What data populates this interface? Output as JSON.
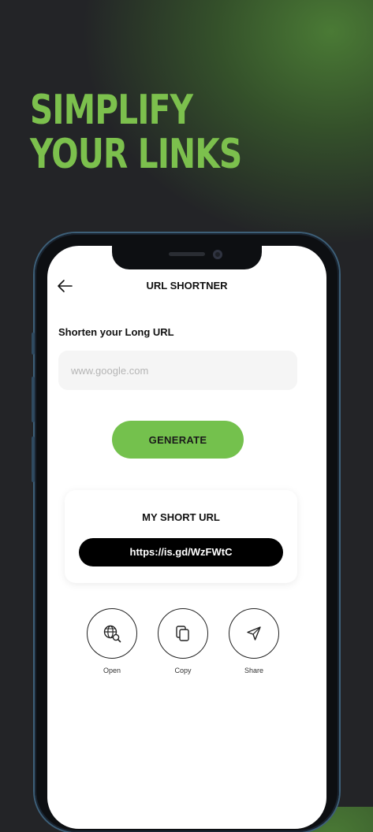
{
  "headline": {
    "line1": "SIMPLIFY",
    "line2": "YOUR LINKS"
  },
  "app": {
    "title": "URL SHORTNER",
    "input_label": "Shorten your Long URL",
    "input_placeholder": "www.google.com",
    "input_value": "",
    "generate_label": "GENERATE",
    "result_title": "MY SHORT URL",
    "short_url": "https://is.gd/WzFWtC",
    "actions": [
      {
        "label": "Open",
        "icon": "globe-search-icon"
      },
      {
        "label": "Copy",
        "icon": "copy-icon"
      },
      {
        "label": "Share",
        "icon": "send-icon"
      }
    ]
  },
  "colors": {
    "accent": "#74c14d",
    "headline": "#7cc04d",
    "background": "#232427"
  }
}
